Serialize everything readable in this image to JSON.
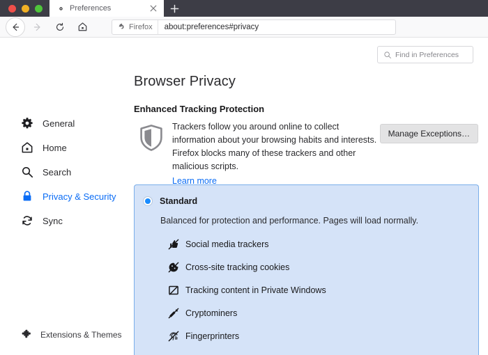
{
  "window": {
    "traffic_lights": [
      "close",
      "minimize",
      "maximize"
    ],
    "colors": {
      "titlebar": "#3d3d46",
      "accent_blue": "#0a6cf5",
      "panel_bg": "#d5e3f8",
      "panel_border": "#7aaeea",
      "radio_selected": "#1a8cff"
    }
  },
  "tabs": {
    "active": {
      "title": "Preferences",
      "favicon": "gear-icon",
      "close_label": "×"
    },
    "new_tab_label": "+"
  },
  "toolbar": {
    "back_label": "Back",
    "forward_label": "Forward",
    "reload_label": "Reload",
    "home_label": "Home",
    "url_chip_label": "Firefox",
    "url": "about:preferences#privacy"
  },
  "search": {
    "placeholder": "Find in Preferences",
    "value": ""
  },
  "sidebar": {
    "items": [
      {
        "id": "general",
        "label": "General",
        "icon": "gear-icon",
        "active": false
      },
      {
        "id": "home",
        "label": "Home",
        "icon": "house-icon",
        "active": false
      },
      {
        "id": "search",
        "label": "Search",
        "icon": "search-icon",
        "active": false
      },
      {
        "id": "privacy",
        "label": "Privacy & Security",
        "icon": "lock-icon",
        "active": true
      },
      {
        "id": "sync",
        "label": "Sync",
        "icon": "sync-icon",
        "active": false
      }
    ],
    "footer": {
      "id": "extensions",
      "label": "Extensions & Themes",
      "icon": "puzzle-piece-icon"
    }
  },
  "main": {
    "page_title": "Browser Privacy",
    "section_title": "Enhanced Tracking Protection",
    "description": "Trackers follow you around online to collect information about your browsing habits and interests. Firefox blocks many of these trackers and other malicious scripts.",
    "learn_more_label": "Learn more",
    "manage_exceptions_label": "Manage Exceptions…",
    "shield_icon": "shield-icon",
    "protection_level": {
      "selected": true,
      "label": "Standard",
      "description": "Balanced for protection and performance. Pages will load normally.",
      "features": [
        {
          "label": "Social media trackers",
          "icon": "social-media-blocked-icon"
        },
        {
          "label": "Cross-site tracking cookies",
          "icon": "cookie-blocked-icon"
        },
        {
          "label": "Tracking content in Private Windows",
          "icon": "tracking-content-blocked-icon"
        },
        {
          "label": "Cryptominers",
          "icon": "cryptominer-blocked-icon"
        },
        {
          "label": "Fingerprinters",
          "icon": "fingerprinter-blocked-icon"
        }
      ]
    }
  }
}
